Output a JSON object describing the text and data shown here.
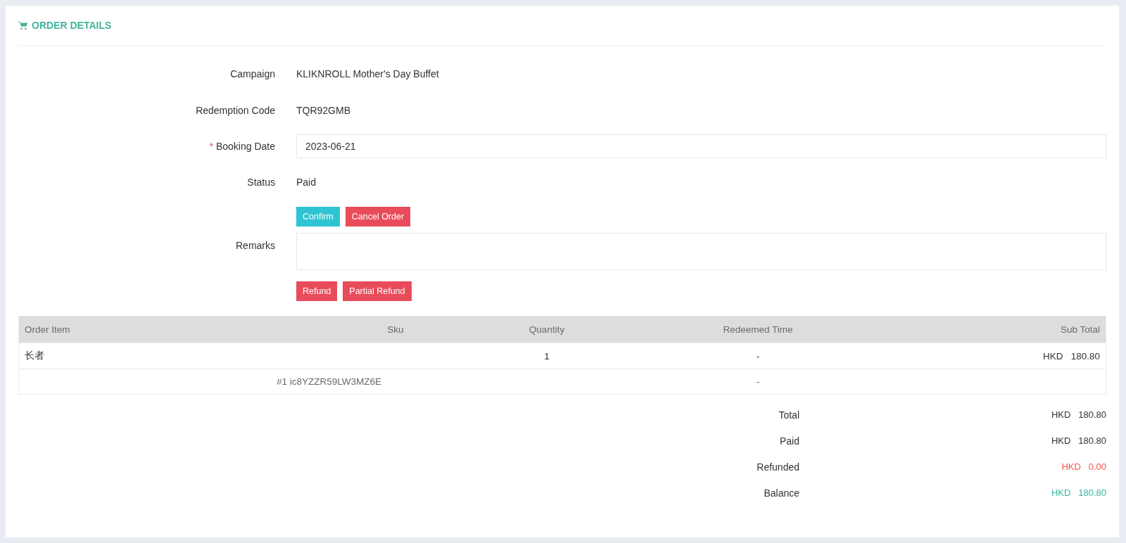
{
  "header": {
    "title": "ORDER DETAILS"
  },
  "fields": [
    {
      "kind": "text",
      "label": "Campaign",
      "value": "KLIKNROLL Mother's Day Buffet"
    },
    {
      "kind": "text",
      "label": "Redemption Code",
      "value": "TQR92GMB"
    },
    {
      "kind": "input",
      "label": "Booking Date",
      "value": "2023-06-21",
      "required_mark": "*"
    },
    {
      "kind": "text",
      "label": "Status",
      "value": "Paid"
    },
    {
      "kind": "buttons",
      "buttons": [
        {
          "label": "Confirm",
          "kind": "info"
        },
        {
          "label": "Cancel Order",
          "kind": "danger"
        }
      ]
    },
    {
      "kind": "textarea",
      "label": "Remarks"
    },
    {
      "kind": "buttons",
      "buttons": [
        {
          "label": "Refund",
          "kind": "danger"
        },
        {
          "label": "Partial Refund",
          "kind": "danger"
        }
      ]
    }
  ],
  "table": {
    "columns": [
      "Order Item",
      "Sku",
      "Quantity",
      "Redeemed Time",
      "Sub Total"
    ],
    "rows": [
      {
        "order_item": "长者",
        "quantity": "1",
        "redeemed_time": "-",
        "currency": "HKD",
        "sub_total": "180.80",
        "units": [
          {
            "sku": "#1 ic8YZZR59LW3MZ6E",
            "redeemed_time": "-"
          }
        ]
      }
    ]
  },
  "totals": [
    {
      "label": "Total",
      "currency": "HKD",
      "amount": "180.80",
      "color": "#333333"
    },
    {
      "label": "Paid",
      "currency": "HKD",
      "amount": "180.80",
      "color": "#333333"
    },
    {
      "label": "Refunded",
      "currency": "HKD",
      "amount": "0.00",
      "color": "#f0554a"
    },
    {
      "label": "Balance",
      "currency": "HKD",
      "amount": "180.80",
      "color": "#3bb5a6"
    }
  ]
}
